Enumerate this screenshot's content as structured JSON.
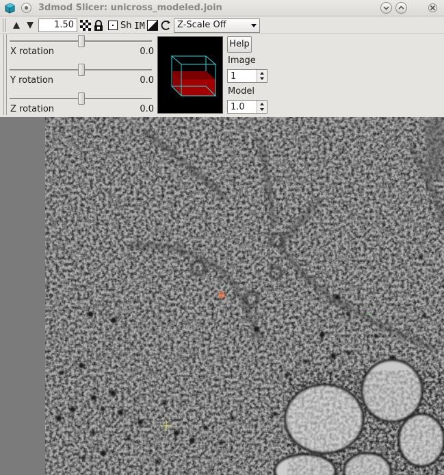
{
  "titlebar": {
    "title": "3dmod Slicer: unicross_modeled.join"
  },
  "toolbar": {
    "zoom_value": "1.50",
    "sh_label": "Sh",
    "zscale_selected": "Z-Scale Off"
  },
  "rotation": {
    "x": {
      "label": "X rotation",
      "value": "0.0"
    },
    "y": {
      "label": "Y rotation",
      "value": "0.0"
    },
    "z": {
      "label": "Z rotation",
      "value": "0.0"
    }
  },
  "controls": {
    "help_label": "Help",
    "image_label": "Image",
    "image_value": "1",
    "model_label": "Model",
    "model_value": "1.0"
  },
  "colors": {
    "cube_edges": "#2fd3d8",
    "cube_fill": "#8b0000",
    "model_point": "#ff6a2a",
    "cursor_cross": "#e8e86a"
  },
  "icons": [
    "app-cube-icon",
    "pin-icon",
    "minimize-icon",
    "maximize-icon",
    "close-icon",
    "zoom-up-icon",
    "zoom-down-icon",
    "checker-icon",
    "lock-icon",
    "dot-box-icon",
    "im-icon",
    "diagonal-icon",
    "rotate-icon",
    "dropdown-arrow-icon"
  ]
}
